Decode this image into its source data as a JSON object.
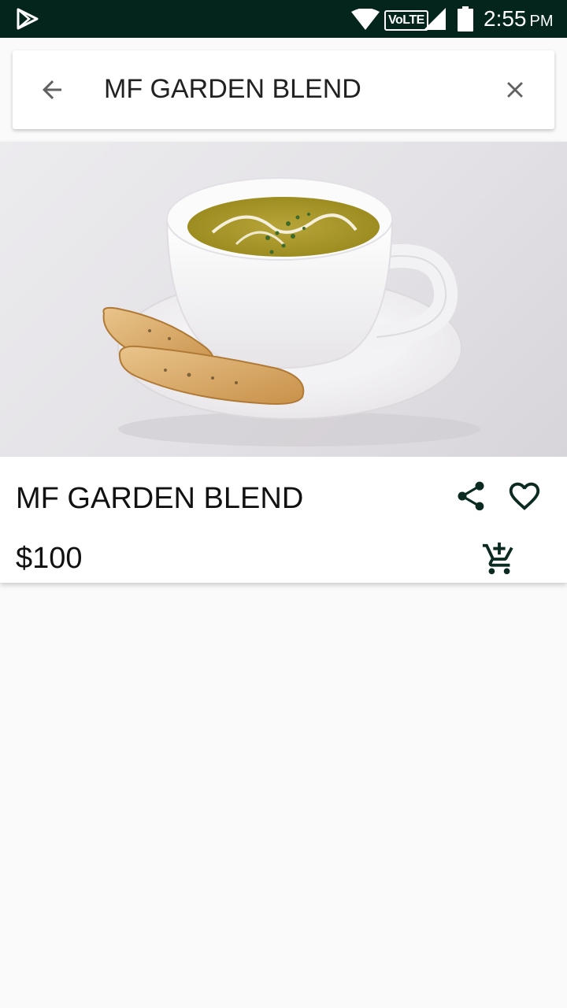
{
  "status_bar": {
    "network_badge": "VoLTE",
    "time": "2:55",
    "ampm": "PM"
  },
  "search": {
    "query": "MF GARDEN BLEND",
    "back_icon": "arrow-left-icon",
    "clear_icon": "close-icon"
  },
  "product": {
    "name": "MF GARDEN BLEND",
    "price": "$100",
    "image_subject": "soup-bowl-with-toast",
    "actions": [
      "share-icon",
      "heart-outline-icon",
      "cart-plus-icon"
    ]
  },
  "colors": {
    "status_bar": "#03251c",
    "icon_dark": "#0b2a22",
    "background": "#fafafa"
  }
}
